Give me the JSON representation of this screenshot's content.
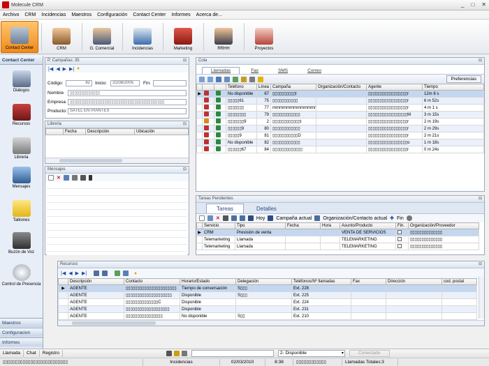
{
  "app": {
    "title": "Molecule CRM"
  },
  "menu": [
    "Archivo",
    "CRM",
    "Incidencias",
    "Maestros",
    "Configuración",
    "Contact Center",
    "Informes",
    "Acerca de..."
  ],
  "ribbon": [
    {
      "label": "Contact Center",
      "active": true
    },
    {
      "label": "CRM"
    },
    {
      "label": "G. Comercial"
    },
    {
      "label": "Incidencias"
    },
    {
      "label": "Marketing"
    },
    {
      "label": "RRHH"
    },
    {
      "label": "Proyectos"
    }
  ],
  "leftnav": {
    "header": "Contact Center",
    "items": [
      "Diálogos",
      "Recursos",
      "Libreria",
      "Mensajes",
      "Tablones",
      "Buzón de Voz",
      "Control de Presencia"
    ],
    "footer": [
      "Maestros",
      "Configuracion",
      "Informes"
    ]
  },
  "campaign": {
    "header": "P. Campañas: 35",
    "codigo_label": "Código:",
    "codigo": "82",
    "inicio_label": "Inicio:",
    "inicio": "31/08/2005",
    "fin_label": "Fin:",
    "fin": "",
    "nombre_label": "Nombre",
    "nombre": "▯▯▯▯▯▯▯▯▯▯▯▯▯",
    "empresa_label": "Empresa",
    "empresa": "▯▯▯▯▯▯▯▯▯▯▯▯▯▯▯▯▯▯▯▯▯▯▯▯▯▯▯▯▯▯▯▯▯▯▯▯▯▯▯▯▯",
    "producto_label": "Producto:",
    "producto": "SATEL ENTRANTES"
  },
  "libreria": {
    "header": "Libreria",
    "columns": [
      "Fecha",
      "Descripción",
      "Ubicación"
    ]
  },
  "mensajes": {
    "header": "Mensajes"
  },
  "cola": {
    "header": "Cola",
    "tabs": [
      "Llamadas",
      "Fax",
      "SMS",
      "Correo"
    ],
    "prefs": "Preferencias",
    "columns": [
      "",
      "",
      "",
      "Teléfono",
      "Línea",
      "Campaña",
      "Organización/Contacto",
      "Agente",
      "Tiempo"
    ],
    "rows": [
      {
        "tel": "No disponible",
        "linea": "67",
        "campana": "▯▯▯▯▯▯▯▯▯▯t",
        "agente": "▯▯▯▯▯▯▯▯▯▯▯▯▯▯▯▯▯r",
        "tiempo": "12m 8 s",
        "sel": true
      },
      {
        "tel": "▯▯▯▯▯61",
        "linea": "75",
        "campana": "▯▯▯▯▯▯▯▯▯▯▯",
        "agente": "▯▯▯▯▯▯▯▯▯▯▯▯▯▯▯▯▯r",
        "tiempo": "6 m 52s"
      },
      {
        "tel": "▯▯▯▯▯▯▯",
        "linea": "77",
        "campana": "mmmmmmmmmmmmmmmmmmm",
        "agente": "▯▯▯▯▯▯▯▯▯▯▯▯▯▯▯▯▯r",
        "tiempo": "4 m 1 s"
      },
      {
        "tel": "▯▯▯▯▯▯▯▯",
        "linea": "79",
        "campana": "▯▯▯▯▯▯▯▯▯▯▯▯",
        "agente": "▯▯▯▯▯▯▯▯▯▯▯▯▯▯▯▯▯M",
        "tiempo": "3 m 15s"
      },
      {
        "tel": "▯▯▯▯▯▯▯9",
        "linea": "2",
        "campana": "▯▯▯▯▯▯▯▯▯▯▯▯t",
        "agente": "▯▯▯▯▯▯▯▯▯▯▯▯▯▯▯▯▯r",
        "tiempo": "2 m 19s"
      },
      {
        "tel": "▯▯▯▯▯▯9",
        "linea": "80",
        "campana": "▯▯▯▯▯▯▯▯▯▯▯▯",
        "agente": "▯▯▯▯▯▯▯▯▯▯▯▯▯▯▯▯▯r",
        "tiempo": "2 m 29s"
      },
      {
        "tel": "▯▯▯▯▯9",
        "linea": "81",
        "campana": "▯▯▯▯▯▯▯▯▯▯▯D",
        "agente": "▯▯▯▯▯▯▯▯▯▯▯▯▯▯▯▯▯r",
        "tiempo": "2 m 21s"
      },
      {
        "tel": "No disponible",
        "linea": "82",
        "campana": "▯▯▯▯▯▯▯▯▯▯▯▯",
        "agente": "▯▯▯▯▯▯▯▯▯▯▯▯▯▯▯▯▯o",
        "tiempo": "1 m 18s"
      },
      {
        "tel": "▯▯▯▯▯▯67",
        "linea": "84",
        "campana": "▯▯▯▯▯▯▯▯▯▯▯▯▯",
        "agente": "▯▯▯▯▯▯▯▯▯▯▯▯▯▯▯▯▯r",
        "tiempo": "0 m 24s"
      }
    ]
  },
  "tareas": {
    "header": "Tareas Pendientes",
    "tabs": [
      "Tareas",
      "Detalles"
    ],
    "tb_hoy": "Hoy",
    "tb_campana": "Campaña actual",
    "tb_org": "Organización/Contacto actual",
    "tb_fin": "Fin",
    "columns": [
      "Servicio",
      "Tipo",
      "Fecha",
      "Hora",
      "Asunto/Producto",
      "Fin.",
      "Organización/Proveedor"
    ],
    "rows": [
      {
        "servicio": "CRM",
        "tipo": "Previsión de venta",
        "asunto": "VENTA DE SERVICIOS",
        "org": "▯▯▯▯▯▯▯▯▯▯▯▯▯▯",
        "sel": true
      },
      {
        "servicio": "Telemarketing",
        "tipo": "Llamada",
        "asunto": "TELEMARKETING",
        "org": "▯▯▯▯▯▯▯▯▯▯▯▯▯▯"
      },
      {
        "servicio": "Telemarketing",
        "tipo": "Llamada",
        "asunto": "TELEMARKETING",
        "org": "▯▯▯▯▯▯▯▯▯▯▯▯▯▯"
      }
    ]
  },
  "recursos": {
    "header": "Recursos",
    "columns": [
      "",
      "Descripción",
      "Contacto",
      "Horario/Estado",
      "Delegación",
      "Teléfonos/Nº llamadas",
      "Fax",
      "Dirección",
      "cod. postal"
    ],
    "rows": [
      {
        "desc": "AGENTE",
        "contacto": "▯▯▯▯▯▯▯▯▯▯▯▯▯▯▯▯▯▯▯▯▯▯",
        "estado": "Tiempo de conversación",
        "deleg": "S▯▯▯",
        "tel": "Ext. 228",
        "sel": true
      },
      {
        "desc": "AGENTE",
        "contacto": "▯▯▯▯▯▯▯▯▯▯▯▯▯▯▯▯▯▯▯▯",
        "estado": "Disponible",
        "deleg": "S▯▯▯",
        "tel": "Ext. 225"
      },
      {
        "desc": "AGENTE",
        "contacto": "▯▯▯▯▯▯▯▯▯▯▯▯▯▯C",
        "estado": "Disponible",
        "deleg": "",
        "tel": "Ext. 224"
      },
      {
        "desc": "AGENTE",
        "contacto": "▯▯▯▯▯▯▯▯▯▯▯▯▯▯▯▯▯▯▯",
        "estado": "Disponible",
        "deleg": "",
        "tel": "Ext. 231"
      },
      {
        "desc": "AGENTE",
        "contacto": "▯▯▯▯▯▯▯▯▯▯▯▯▯▯▯▯",
        "estado": "No disponible",
        "deleg": "S▯▯",
        "tel": "Ext. 210"
      }
    ]
  },
  "statusbar": {
    "tabs": [
      "Llamada",
      "Chat",
      "Registro"
    ],
    "estado": "2- Disponible",
    "conectado": "Conectado",
    "bottom": [
      "▯▯▯▯▯▯▯▯▯▯▯▯▯▯▯▯▯▯▯▯▯▯▯▯▯▯",
      "Incidencias",
      "02/03/2010",
      "8:38",
      "▯▯▯▯▯▯▯▯▯▯▯▯",
      "Llamadas Totales:3"
    ]
  },
  "colors": {
    "accent": "#f08a1a",
    "navbg": "#dde7f5",
    "selrow": "#c4d7f0"
  }
}
